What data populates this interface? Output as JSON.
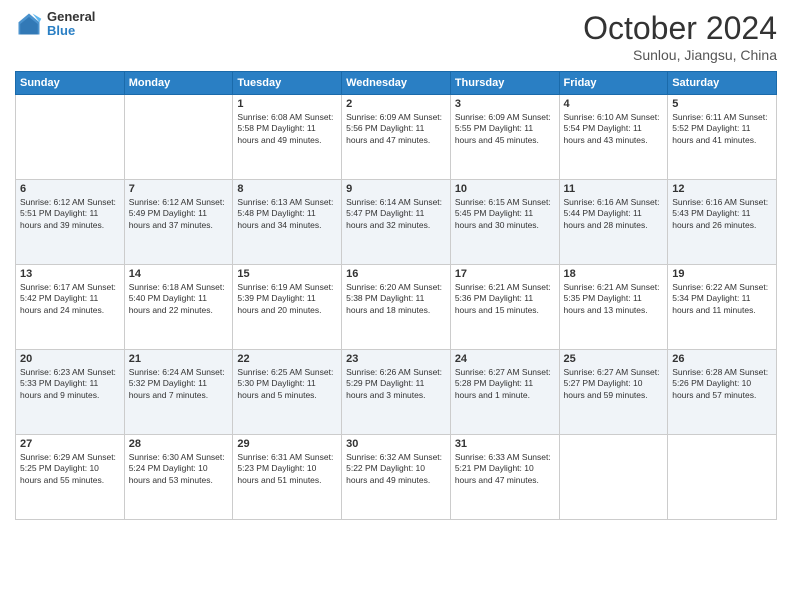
{
  "logo": {
    "general": "General",
    "blue": "Blue"
  },
  "header": {
    "month": "October 2024",
    "location": "Sunlou, Jiangsu, China"
  },
  "weekdays": [
    "Sunday",
    "Monday",
    "Tuesday",
    "Wednesday",
    "Thursday",
    "Friday",
    "Saturday"
  ],
  "weeks": [
    [
      {
        "day": "",
        "info": ""
      },
      {
        "day": "",
        "info": ""
      },
      {
        "day": "1",
        "info": "Sunrise: 6:08 AM\nSunset: 5:58 PM\nDaylight: 11 hours and 49 minutes."
      },
      {
        "day": "2",
        "info": "Sunrise: 6:09 AM\nSunset: 5:56 PM\nDaylight: 11 hours and 47 minutes."
      },
      {
        "day": "3",
        "info": "Sunrise: 6:09 AM\nSunset: 5:55 PM\nDaylight: 11 hours and 45 minutes."
      },
      {
        "day": "4",
        "info": "Sunrise: 6:10 AM\nSunset: 5:54 PM\nDaylight: 11 hours and 43 minutes."
      },
      {
        "day": "5",
        "info": "Sunrise: 6:11 AM\nSunset: 5:52 PM\nDaylight: 11 hours and 41 minutes."
      }
    ],
    [
      {
        "day": "6",
        "info": "Sunrise: 6:12 AM\nSunset: 5:51 PM\nDaylight: 11 hours and 39 minutes."
      },
      {
        "day": "7",
        "info": "Sunrise: 6:12 AM\nSunset: 5:49 PM\nDaylight: 11 hours and 37 minutes."
      },
      {
        "day": "8",
        "info": "Sunrise: 6:13 AM\nSunset: 5:48 PM\nDaylight: 11 hours and 34 minutes."
      },
      {
        "day": "9",
        "info": "Sunrise: 6:14 AM\nSunset: 5:47 PM\nDaylight: 11 hours and 32 minutes."
      },
      {
        "day": "10",
        "info": "Sunrise: 6:15 AM\nSunset: 5:45 PM\nDaylight: 11 hours and 30 minutes."
      },
      {
        "day": "11",
        "info": "Sunrise: 6:16 AM\nSunset: 5:44 PM\nDaylight: 11 hours and 28 minutes."
      },
      {
        "day": "12",
        "info": "Sunrise: 6:16 AM\nSunset: 5:43 PM\nDaylight: 11 hours and 26 minutes."
      }
    ],
    [
      {
        "day": "13",
        "info": "Sunrise: 6:17 AM\nSunset: 5:42 PM\nDaylight: 11 hours and 24 minutes."
      },
      {
        "day": "14",
        "info": "Sunrise: 6:18 AM\nSunset: 5:40 PM\nDaylight: 11 hours and 22 minutes."
      },
      {
        "day": "15",
        "info": "Sunrise: 6:19 AM\nSunset: 5:39 PM\nDaylight: 11 hours and 20 minutes."
      },
      {
        "day": "16",
        "info": "Sunrise: 6:20 AM\nSunset: 5:38 PM\nDaylight: 11 hours and 18 minutes."
      },
      {
        "day": "17",
        "info": "Sunrise: 6:21 AM\nSunset: 5:36 PM\nDaylight: 11 hours and 15 minutes."
      },
      {
        "day": "18",
        "info": "Sunrise: 6:21 AM\nSunset: 5:35 PM\nDaylight: 11 hours and 13 minutes."
      },
      {
        "day": "19",
        "info": "Sunrise: 6:22 AM\nSunset: 5:34 PM\nDaylight: 11 hours and 11 minutes."
      }
    ],
    [
      {
        "day": "20",
        "info": "Sunrise: 6:23 AM\nSunset: 5:33 PM\nDaylight: 11 hours and 9 minutes."
      },
      {
        "day": "21",
        "info": "Sunrise: 6:24 AM\nSunset: 5:32 PM\nDaylight: 11 hours and 7 minutes."
      },
      {
        "day": "22",
        "info": "Sunrise: 6:25 AM\nSunset: 5:30 PM\nDaylight: 11 hours and 5 minutes."
      },
      {
        "day": "23",
        "info": "Sunrise: 6:26 AM\nSunset: 5:29 PM\nDaylight: 11 hours and 3 minutes."
      },
      {
        "day": "24",
        "info": "Sunrise: 6:27 AM\nSunset: 5:28 PM\nDaylight: 11 hours and 1 minute."
      },
      {
        "day": "25",
        "info": "Sunrise: 6:27 AM\nSunset: 5:27 PM\nDaylight: 10 hours and 59 minutes."
      },
      {
        "day": "26",
        "info": "Sunrise: 6:28 AM\nSunset: 5:26 PM\nDaylight: 10 hours and 57 minutes."
      }
    ],
    [
      {
        "day": "27",
        "info": "Sunrise: 6:29 AM\nSunset: 5:25 PM\nDaylight: 10 hours and 55 minutes."
      },
      {
        "day": "28",
        "info": "Sunrise: 6:30 AM\nSunset: 5:24 PM\nDaylight: 10 hours and 53 minutes."
      },
      {
        "day": "29",
        "info": "Sunrise: 6:31 AM\nSunset: 5:23 PM\nDaylight: 10 hours and 51 minutes."
      },
      {
        "day": "30",
        "info": "Sunrise: 6:32 AM\nSunset: 5:22 PM\nDaylight: 10 hours and 49 minutes."
      },
      {
        "day": "31",
        "info": "Sunrise: 6:33 AM\nSunset: 5:21 PM\nDaylight: 10 hours and 47 minutes."
      },
      {
        "day": "",
        "info": ""
      },
      {
        "day": "",
        "info": ""
      }
    ]
  ]
}
